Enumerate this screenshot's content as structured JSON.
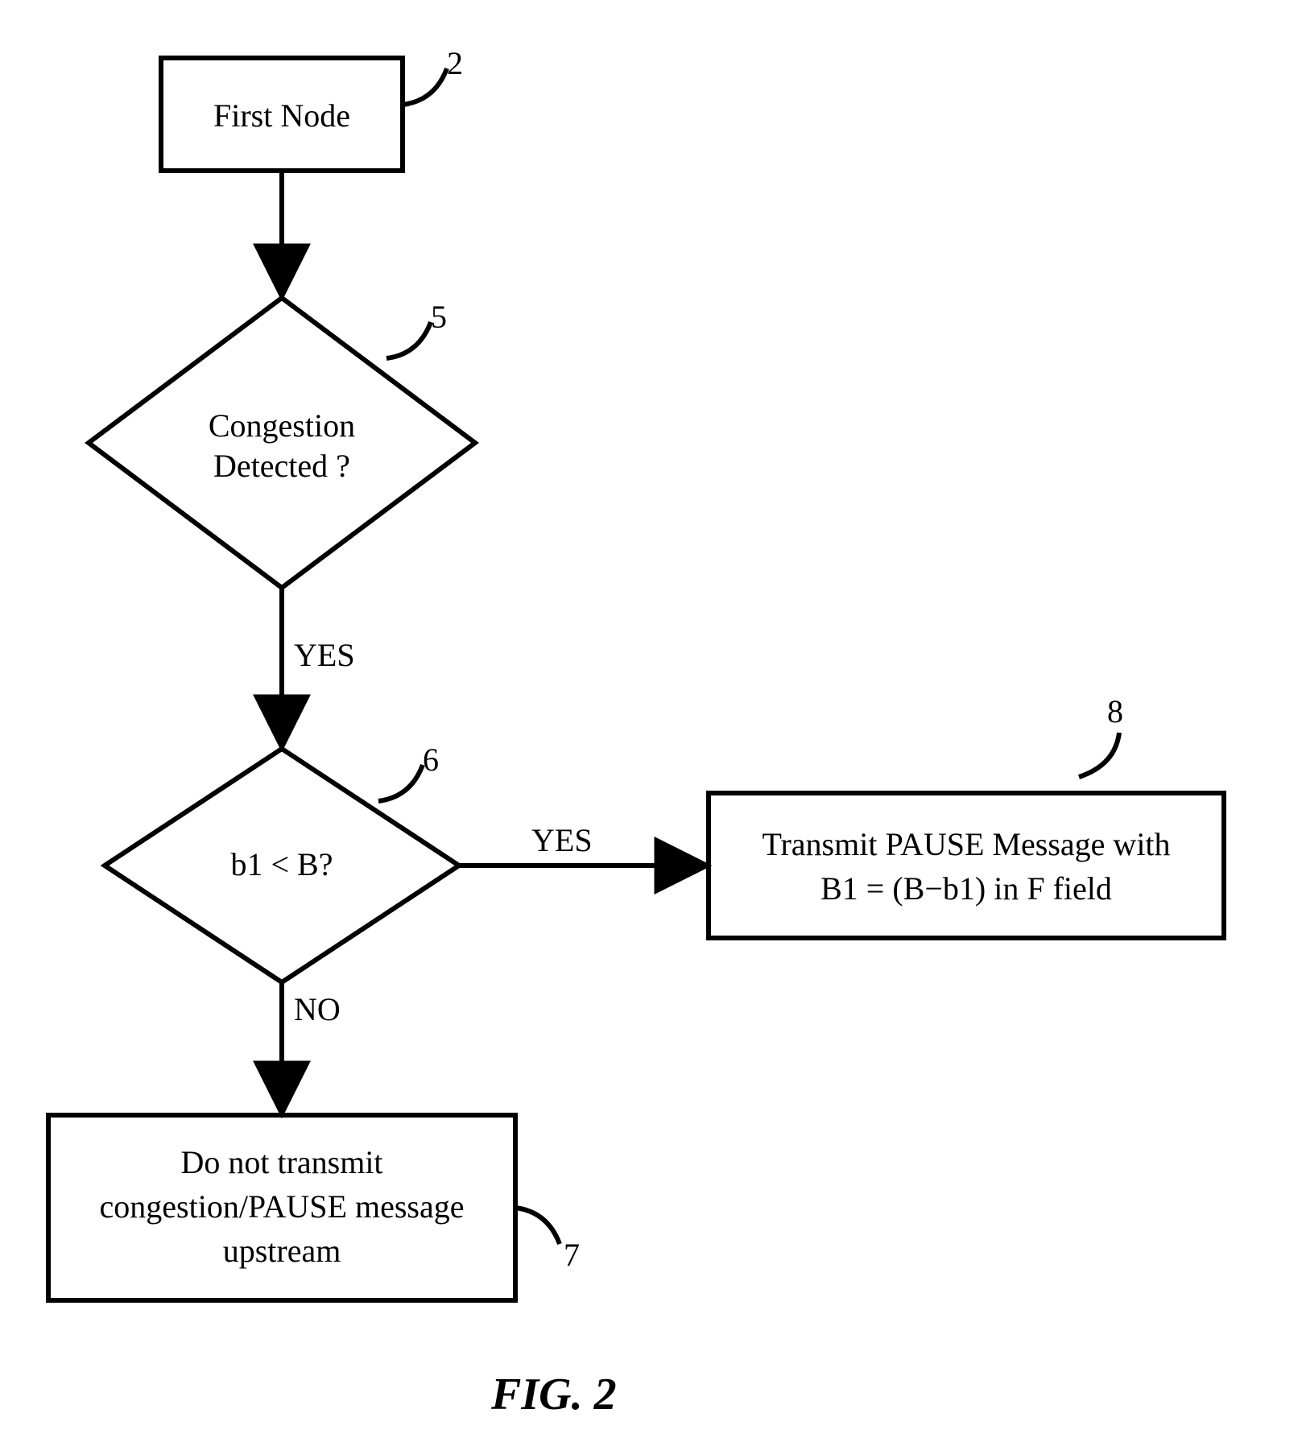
{
  "nodes": {
    "first_node": {
      "text": "First Node",
      "ref": "2"
    },
    "congestion": {
      "line1": "Congestion",
      "line2": "Detected ?",
      "ref": "5"
    },
    "compare": {
      "text": "b1 < B?",
      "ref": "6"
    },
    "no_transmit": {
      "line1": "Do not transmit",
      "line2": "congestion/PAUSE message",
      "line3": "upstream",
      "ref": "7"
    },
    "transmit": {
      "line1": "Transmit PAUSE Message with",
      "line2": "B1 = (B−b1) in F field",
      "ref": "8"
    }
  },
  "edges": {
    "yes1": "YES",
    "yes2": "YES",
    "no": "NO"
  },
  "caption": "FIG.  2"
}
